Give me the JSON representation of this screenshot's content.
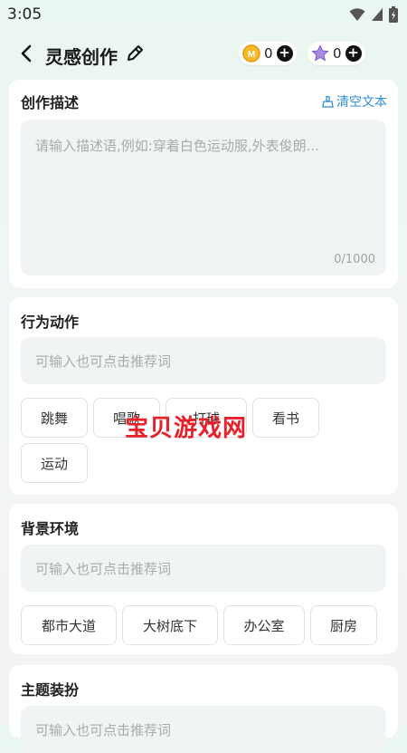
{
  "status_bar": {
    "time": "3:05"
  },
  "header": {
    "title": "灵感创作"
  },
  "currency": {
    "coins": "0",
    "stars": "0"
  },
  "description_card": {
    "title": "创作描述",
    "clear_label": "清空文本",
    "placeholder": "请输入描述语,例如:穿着白色运动服,外表俊朗...",
    "counter": "0/1000"
  },
  "action_card": {
    "title": "行为动作",
    "placeholder": "可输入也可点击推荐词",
    "chips": [
      "跳舞",
      "唱歌",
      "打球",
      "看书",
      "运动"
    ]
  },
  "background_card": {
    "title": "背景环境",
    "placeholder": "可输入也可点击推荐词",
    "chips": [
      "都市大道",
      "大树底下",
      "办公室",
      "厨房"
    ]
  },
  "theme_card": {
    "title": "主题装扮",
    "placeholder": "可输入也可点击推荐词"
  },
  "watermark": "宝贝游戏网"
}
